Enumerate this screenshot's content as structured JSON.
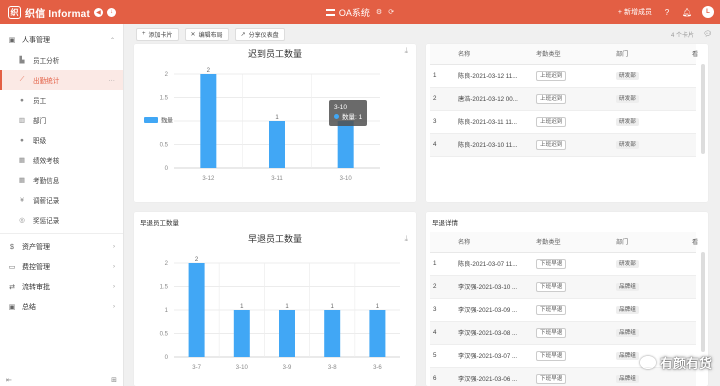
{
  "topbar": {
    "brand": "织信 Informat",
    "app_title": "OA系统",
    "new_member": "新增成员",
    "avatar": "L",
    "bg_color": "#e35f44"
  },
  "sidebar": {
    "group_hr": "人事管理",
    "items": [
      {
        "label": "员工分析",
        "icon": "chart-icon"
      },
      {
        "label": "出勤统计",
        "icon": "trend-icon",
        "active": true
      },
      {
        "label": "员工",
        "icon": "user-icon"
      },
      {
        "label": "部门",
        "icon": "dept-icon"
      },
      {
        "label": "职级",
        "icon": "level-icon"
      },
      {
        "label": "绩效考核",
        "icon": "table-icon"
      },
      {
        "label": "考勤信息",
        "icon": "table-icon"
      },
      {
        "label": "调薪记录",
        "icon": "yen-icon"
      },
      {
        "label": "奖惩记录",
        "icon": "medal-icon"
      }
    ],
    "groups": [
      "资产管理",
      "费控管理",
      "流转审批",
      "总结"
    ]
  },
  "toolbar": {
    "add_card": "添加卡片",
    "edit_layout": "编辑布局",
    "share_dashboard": "分享仪表盘",
    "card_count": "4 个卡片"
  },
  "late_chart": {
    "title": "迟到员工数量",
    "tooltip_date": "3-10",
    "tooltip_label": "数量: 1"
  },
  "early_card": {
    "label": "早退员工数量",
    "title": "早退员工数量"
  },
  "late_table": {
    "headers": [
      "",
      "名称",
      "考勤类型",
      "部门",
      "看"
    ],
    "rows": [
      [
        "1",
        "陈良-2021-03-12 11...",
        "上班迟到",
        "研发部"
      ],
      [
        "2",
        "唐浩-2021-03-12 00...",
        "上班迟到",
        "研发部"
      ],
      [
        "3",
        "陈良-2021-03-11 11...",
        "上班迟到",
        "研发部"
      ],
      [
        "4",
        "陈良-2021-03-10 11...",
        "上班迟到",
        "研发部"
      ]
    ]
  },
  "early_table": {
    "label": "早退详情",
    "headers": [
      "",
      "名称",
      "考勤类型",
      "部门",
      "看"
    ],
    "rows": [
      [
        "1",
        "陈良-2021-03-07 11...",
        "下班早退",
        "研发部"
      ],
      [
        "2",
        "李汉强-2021-03-10 ...",
        "下班早退",
        "品牌组"
      ],
      [
        "3",
        "李汉强-2021-03-09 ...",
        "下班早退",
        "品牌组"
      ],
      [
        "4",
        "李汉强-2021-03-08 ...",
        "下班早退",
        "品牌组"
      ],
      [
        "5",
        "李汉强-2021-03-07 ...",
        "下班早退",
        "品牌组"
      ],
      [
        "6",
        "李汉强-2021-03-06 ...",
        "下班早退",
        "品牌组"
      ]
    ]
  },
  "watermark": "有颜有货",
  "chart_data": [
    {
      "type": "bar",
      "title": "迟到员工数量",
      "categories": [
        "3-12",
        "3-11",
        "3-10"
      ],
      "series": [
        {
          "name": "数量",
          "values": [
            2,
            1,
            1
          ]
        }
      ],
      "ylim": [
        0,
        2
      ],
      "yticks": [
        "0",
        "0.5",
        "1",
        "1.5",
        "2"
      ],
      "legend": "left",
      "color": "#41a7f5"
    },
    {
      "type": "bar",
      "title": "早退员工数量",
      "categories": [
        "3-7",
        "3-10",
        "3-9",
        "3-8",
        "3-6"
      ],
      "series": [
        {
          "name": "数量",
          "values": [
            2,
            1,
            1,
            1,
            1
          ]
        }
      ],
      "ylim": [
        0,
        2
      ],
      "yticks": [
        "0",
        "0.5",
        "1",
        "1.5",
        "2"
      ],
      "color": "#41a7f5"
    }
  ]
}
